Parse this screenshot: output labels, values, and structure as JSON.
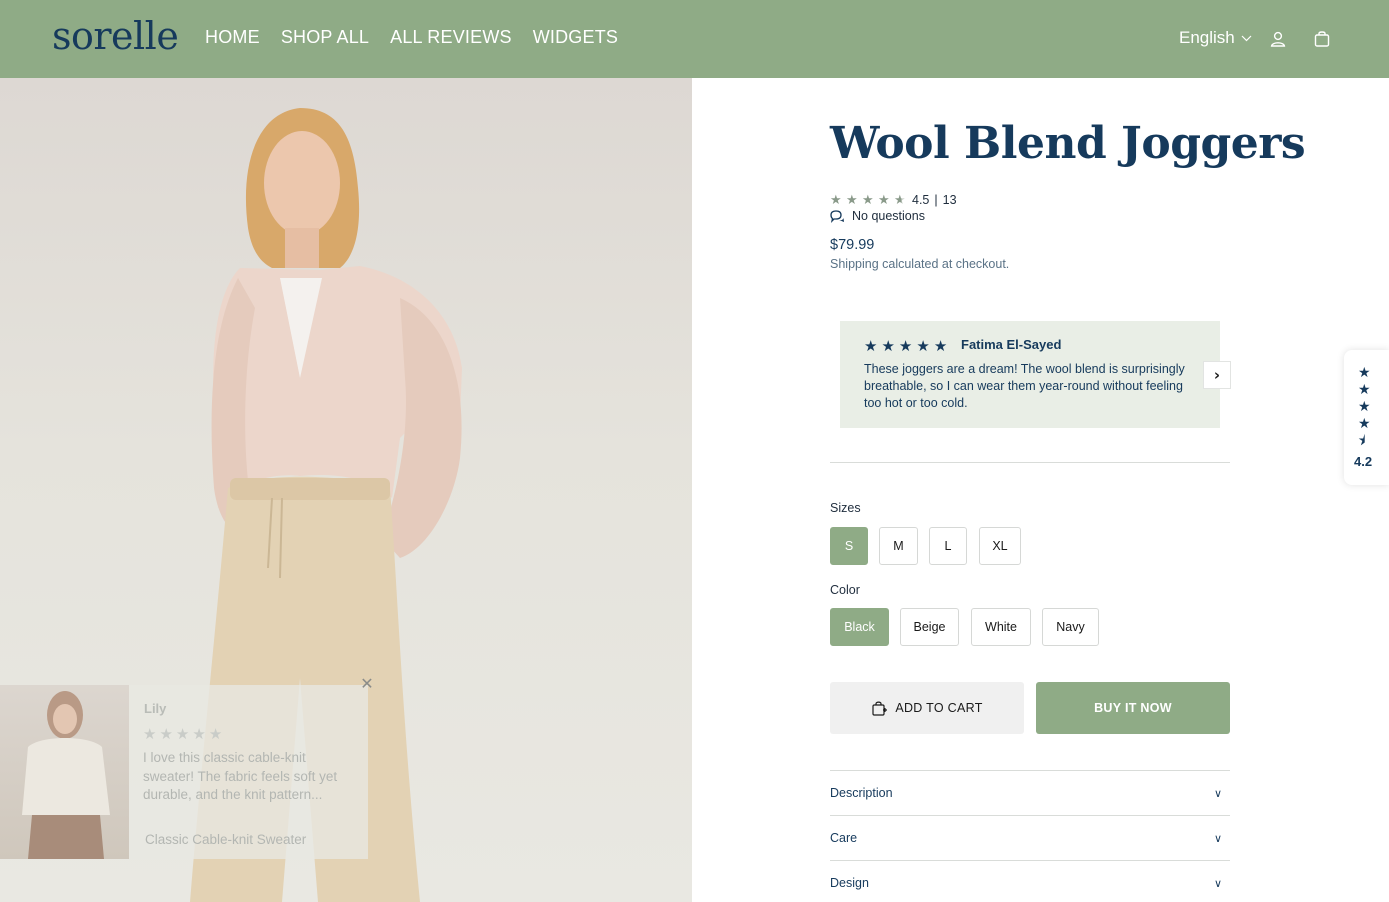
{
  "header": {
    "logo": "sorelle",
    "nav": [
      "HOME",
      "SHOP ALL",
      "ALL REVIEWS",
      "WIDGETS"
    ],
    "language": "English",
    "account_icon": "user-icon",
    "cart_icon": "bag-icon",
    "background_color": "#8fab86"
  },
  "product": {
    "title": "Wool Blend Joggers",
    "rating": "4.5",
    "rating_stars": 4.5,
    "separator": "|",
    "review_count": "13",
    "questions": "No questions",
    "price": "$79.99",
    "shipping": "Shipping calculated at checkout."
  },
  "featured_review": {
    "author": "Fatima El-Sayed",
    "stars": 5,
    "text": "These joggers are a dream! The wool blend is surprisingly breathable, so I can wear them year-round without feeling too hot or too cold."
  },
  "popup_review": {
    "author": "Lily",
    "stars": 5,
    "text": "I love this classic cable-knit sweater! The fabric feels soft yet durable, and the knit pattern...",
    "product": "Classic Cable-knit Sweater"
  },
  "options": {
    "sizes_label": "Sizes",
    "sizes": [
      "S",
      "M",
      "L",
      "XL"
    ],
    "selected_size": "S",
    "color_label": "Color",
    "colors": [
      "Black",
      "Beige",
      "White",
      "Navy"
    ],
    "selected_color": "Black"
  },
  "actions": {
    "add_to_cart": "ADD TO CART",
    "buy_now": "BUY IT NOW"
  },
  "accordion": [
    "Description",
    "Care",
    "Design"
  ],
  "side_widget": {
    "rating": "4.2",
    "stars": 4.5
  },
  "colors": {
    "brand_green": "#8fab86",
    "navy": "#163a5c",
    "review_bg": "#e9eee6"
  }
}
